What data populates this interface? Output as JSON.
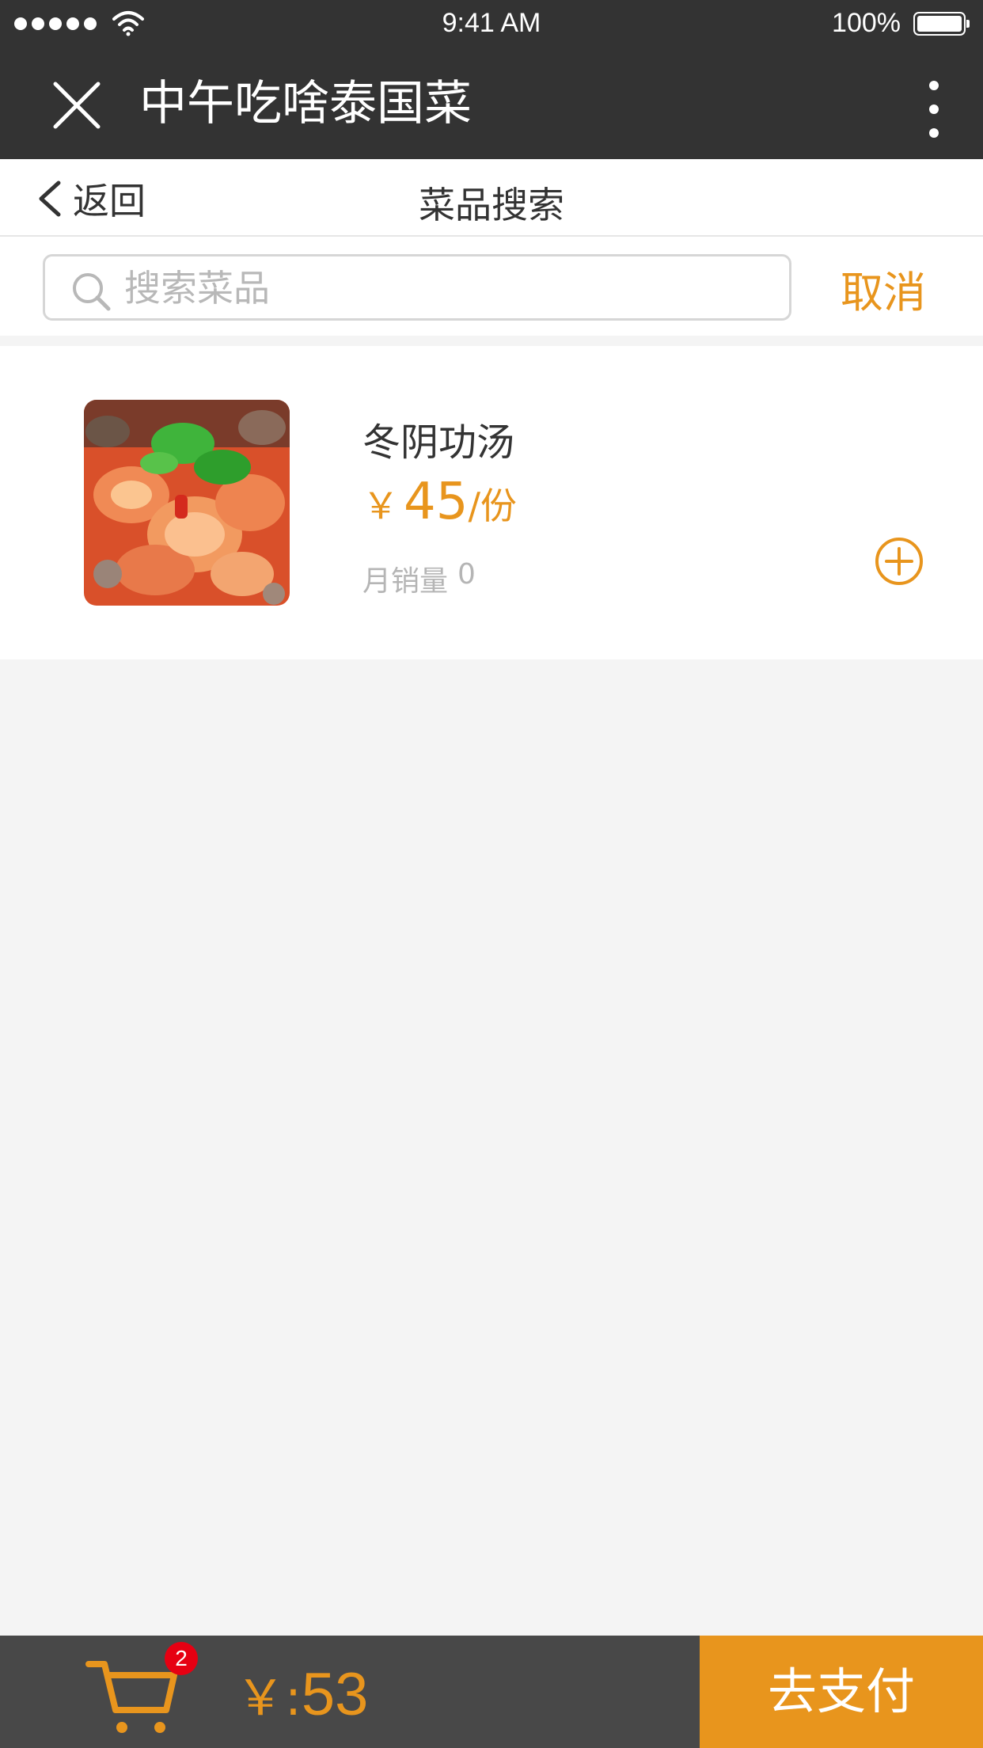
{
  "status_bar": {
    "time": "9:41 AM",
    "battery": "100%"
  },
  "app_bar": {
    "title": "中午吃啥泰国菜",
    "icons": {
      "close": "close-icon",
      "more": "more-vertical-icon"
    }
  },
  "nav": {
    "back_label": "返回",
    "title": "菜品搜索"
  },
  "search": {
    "value": "",
    "placeholder": "搜索菜品",
    "cancel_label": "取消"
  },
  "results": [
    {
      "name": "冬阴功汤",
      "currency": "￥",
      "price": "45",
      "unit": "/份",
      "sales_label": "月销量",
      "sales_count": "0",
      "image": "tom-yum-soup-photo"
    }
  ],
  "cart": {
    "badge_count": "2",
    "total_symbol": "￥:",
    "total_value": "53",
    "pay_label": "去支付"
  },
  "colors": {
    "accent": "#e8951d",
    "header_bg": "#333333",
    "bottom_bg": "#484848",
    "badge": "#e60012"
  }
}
